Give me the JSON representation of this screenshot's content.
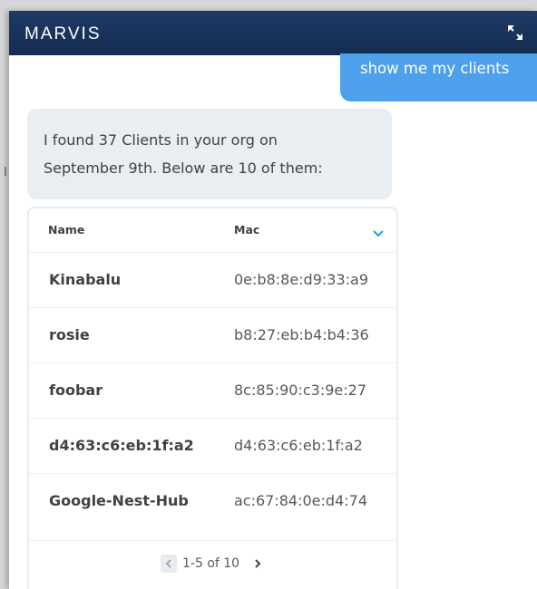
{
  "window": {
    "title": "MARVIS",
    "expand_icon": "expand-arrows-icon"
  },
  "chat": {
    "user_message": "show me my clients",
    "bot_line1": "I found 37 Clients in your org on",
    "bot_line2": "September 9th. Below are 10 of them:"
  },
  "table": {
    "columns": [
      "Name",
      "Mac"
    ],
    "sort_icon": "chevron-down-icon",
    "rows": [
      {
        "name": "Kinabalu",
        "mac": "0e:b8:8e:d9:33:a9"
      },
      {
        "name": "rosie",
        "mac": "b8:27:eb:b4:b4:36"
      },
      {
        "name": "foobar",
        "mac": "8c:85:90:c3:9e:27"
      },
      {
        "name": "d4:63:c6:eb:1f:a2",
        "mac": "d4:63:c6:eb:1f:a2"
      },
      {
        "name": "Google-Nest-Hub",
        "mac": "ac:67:84:0e:d4:74"
      }
    ],
    "pagination": {
      "label": "1-5 of 10",
      "prev_icon": "chevron-left-icon",
      "next_icon": "chevron-right-icon"
    }
  },
  "colors": {
    "header_bg": "#1a3360",
    "user_bubble": "#4ea0ec",
    "bot_bubble": "#e9eef2",
    "accent": "#2a9ae6"
  }
}
